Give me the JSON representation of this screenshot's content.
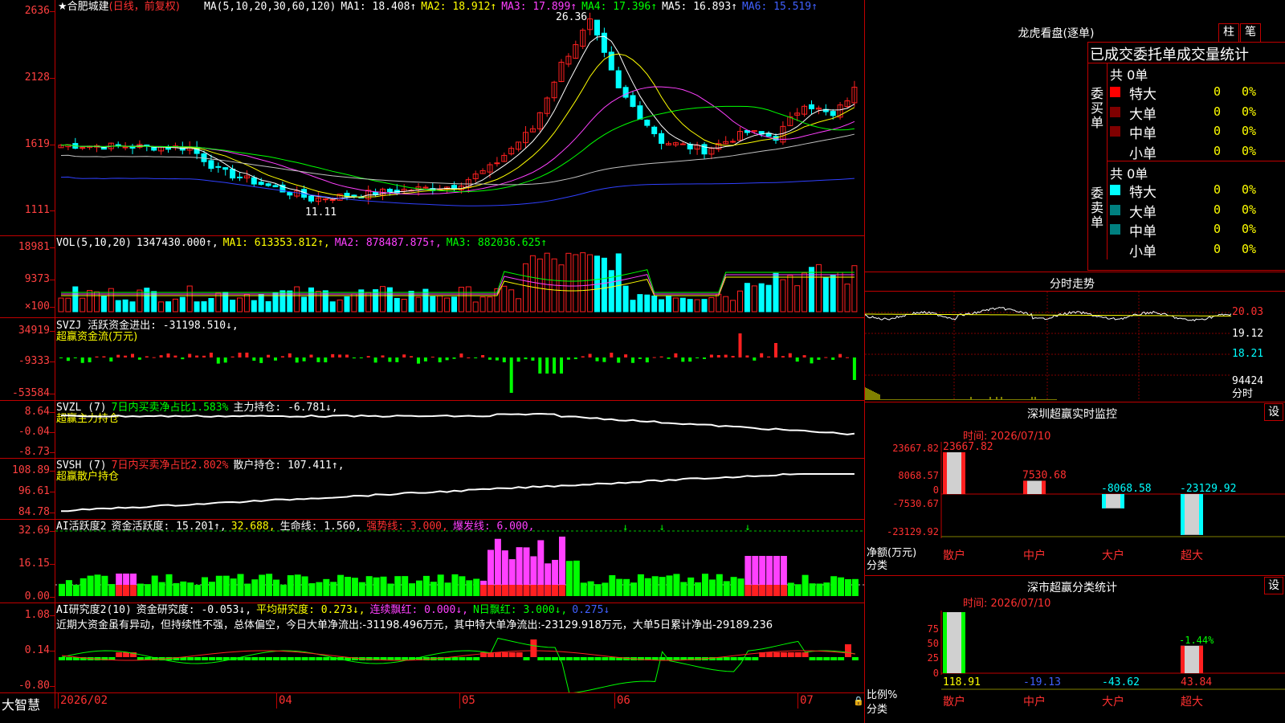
{
  "stock": {
    "name": "合肥城建",
    "mode": "(日线，前复权)"
  },
  "ma_line": [
    {
      "t": "MA(5,10,20,30,60,120)",
      "c": "#ffffff"
    },
    {
      "t": "MA1: 18.408↑",
      "c": "#ffffff"
    },
    {
      "t": "MA2: 18.912↑",
      "c": "#ffff00"
    },
    {
      "t": "MA3: 17.899↑",
      "c": "#ff40ff"
    },
    {
      "t": "MA4: 17.396↑",
      "c": "#00ff00"
    },
    {
      "t": "MA5: 16.893↑",
      "c": "#ffffff"
    },
    {
      "t": "MA6: 15.519↑",
      "c": "#4060ff"
    }
  ],
  "price_axis": [
    "2636",
    "2128",
    "1619",
    "1111"
  ],
  "price_marks": {
    "high": "26.36",
    "low": "11.11"
  },
  "vol_line": [
    {
      "t": "VOL(5,10,20)",
      "c": "#ffffff"
    },
    {
      "t": "1347430.000↑,",
      "c": "#ffffff"
    },
    {
      "t": "MA1: 613353.812↑,",
      "c": "#ffff00"
    },
    {
      "t": "MA2: 878487.875↑,",
      "c": "#ff40ff"
    },
    {
      "t": "MA3: 882036.625↑",
      "c": "#00ff00"
    }
  ],
  "vol_axis": [
    "18981",
    "9373",
    "×100"
  ],
  "svzj": {
    "line1": [
      {
        "t": "SVZJ  活跃资金进出: -31198.510↓,",
        "c": "#ffffff"
      }
    ],
    "line2": "超赢资金流(万元)",
    "axis": [
      "34919",
      "-9333",
      "-53584"
    ]
  },
  "svzl": {
    "line1": [
      {
        "t": "SVZL (7)",
        "c": "#ffffff"
      },
      {
        "t": "7日内买卖净占比1.583%",
        "c": "#00ff00"
      },
      {
        "t": "主力持仓: -6.781↓,",
        "c": "#ffffff"
      }
    ],
    "line2": "超赢主力持仓",
    "axis": [
      "8.64",
      "-0.04",
      "-8.73"
    ]
  },
  "svsh": {
    "line1": [
      {
        "t": "SVSH (7)",
        "c": "#ffffff"
      },
      {
        "t": "7日内买卖净占比2.802%",
        "c": "#ff3030"
      },
      {
        "t": "散户持仓: 107.411↑,",
        "c": "#ffffff"
      }
    ],
    "line2": "超赢散户持仓",
    "axis": [
      "108.89",
      "96.61",
      "84.78"
    ]
  },
  "ai1": {
    "line1": [
      {
        "t": "AI活跃度2",
        "c": "#ffffff"
      },
      {
        "t": "资金活跃度: 15.201↑,",
        "c": "#ffffff"
      },
      {
        "t": "32.688,",
        "c": "#ffff00"
      },
      {
        "t": "生命线: 1.560,",
        "c": "#ffffff"
      },
      {
        "t": "强势线: 3.000,",
        "c": "#ff3030"
      },
      {
        "t": "爆发线: 6.000,",
        "c": "#ff40ff"
      }
    ],
    "axis": [
      "32.69",
      "16.15",
      "0.00"
    ]
  },
  "ai2": {
    "line1": [
      {
        "t": "AI研究度2(10)",
        "c": "#ffffff"
      },
      {
        "t": "资金研究度: -0.053↓,",
        "c": "#ffffff"
      },
      {
        "t": "平均研究度: 0.273↓,",
        "c": "#ffff00"
      },
      {
        "t": "连续飘红: 0.000↓,",
        "c": "#ff40ff"
      },
      {
        "t": "N日飘红: 3.000↓,",
        "c": "#00ff00"
      },
      {
        "t": "0.275↓",
        "c": "#4060ff"
      }
    ],
    "line2": "近期大资金虽有异动，但持续性不强，总体偏空，今日大单净流出:-31198.496万元，其中特大单净流出:-23129.918万元，大单5日累计净出-29189.236",
    "axis": [
      "1.08",
      "0.14",
      "-0.80"
    ]
  },
  "date_axis": {
    "brand": "大智慧",
    "dates": [
      "2026/02",
      "04",
      "05",
      "06",
      "07"
    ]
  },
  "right": {
    "lhb_title": "龙虎看盘(逐单)",
    "btn1": "柱",
    "btn2": "笔",
    "trade_title": "已成交委托单成交量统计",
    "buy_label": "委买单",
    "sell_label": "委卖单",
    "buy_total": "共 0单",
    "sell_total": "共 0单",
    "buy_rows": [
      {
        "label": "特大",
        "val": "0",
        "pct": "0%",
        "color": "#ff0000"
      },
      {
        "label": "大单",
        "val": "0",
        "pct": "0%",
        "color": "#800000"
      },
      {
        "label": "中单",
        "val": "0",
        "pct": "0%",
        "color": "#800000"
      },
      {
        "label": "小单",
        "val": "0",
        "pct": "0%",
        "color": ""
      }
    ],
    "sell_rows": [
      {
        "label": "特大",
        "val": "0",
        "pct": "0%",
        "color": "#00ffff"
      },
      {
        "label": "大单",
        "val": "0",
        "pct": "0%",
        "color": "#008080"
      },
      {
        "label": "中单",
        "val": "0",
        "pct": "0%",
        "color": "#008080"
      },
      {
        "label": "小单",
        "val": "0",
        "pct": "0%",
        "color": ""
      }
    ],
    "fs_title": "分时走势",
    "fs_axis": [
      "20.03",
      "19.12",
      "18.21",
      "94424",
      "分时"
    ],
    "mon_title": "深圳超赢实时监控",
    "mon_btn": "设",
    "mon_time": "时间: 2026/07/10",
    "mon_axis": [
      "23667.82",
      "8068.57",
      "0",
      "-7530.67",
      "-23129.92"
    ],
    "mon_unit": "净额(万元)",
    "mon_cat_label": "分类",
    "mon_bars": [
      {
        "cat": "散户",
        "val": 23667.82,
        "label": "23667.82",
        "lc": "#ff3030"
      },
      {
        "cat": "中户",
        "val": 7530.68,
        "label": "7530.68",
        "lc": "#ff3030"
      },
      {
        "cat": "大户",
        "val": -8068.58,
        "label": "-8068.58",
        "lc": "#00ffff"
      },
      {
        "cat": "超大",
        "val": -23129.92,
        "label": "-23129.92",
        "lc": "#00ffff"
      }
    ],
    "cls_title": "深市超赢分类统计",
    "cls_btn": "设",
    "cls_time": "时间: 2026/07/10",
    "cls_axis": [
      "75",
      "50",
      "25",
      "0"
    ],
    "cls_unit": "比例%",
    "cls_cat_label": "分类",
    "cls_top_label": "-1.44%",
    "cls_bars": [
      {
        "cat": "散户",
        "val": 118.91,
        "label": "118.91",
        "lc": "#ffff00"
      },
      {
        "cat": "中户",
        "val": -19.13,
        "label": "-19.13",
        "lc": "#4060ff"
      },
      {
        "cat": "大户",
        "val": -43.62,
        "label": "-43.62",
        "lc": "#00ffff"
      },
      {
        "cat": "超大",
        "val": 43.84,
        "label": "43.84",
        "lc": "#ff3030"
      }
    ]
  }
}
